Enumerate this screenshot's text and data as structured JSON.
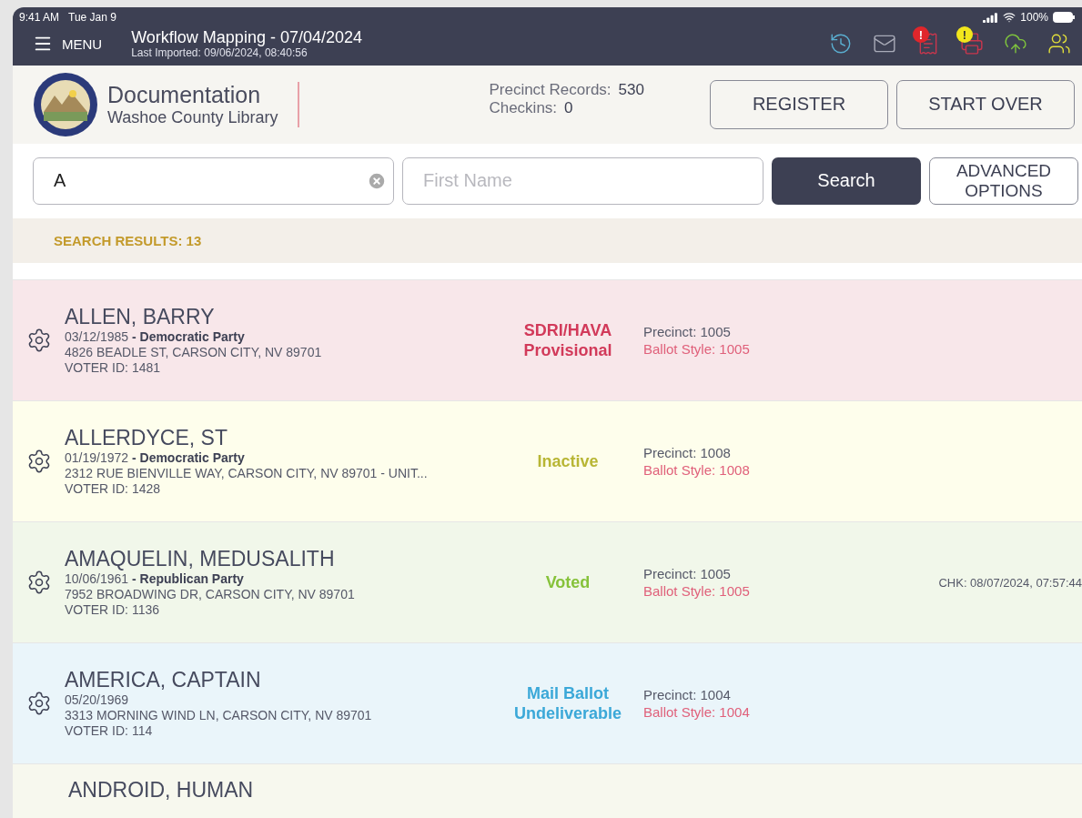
{
  "status_bar": {
    "time": "9:41 AM",
    "date": "Tue Jan 9",
    "battery": "100%"
  },
  "title_bar": {
    "menu": "MENU",
    "title": "Workflow Mapping - 07/04/2024",
    "subtitle": "Last Imported: 09/06/2024, 08:40:56",
    "tools": [
      {
        "kind": "history"
      },
      {
        "kind": "mail"
      },
      {
        "kind": "ballot",
        "badge": "!",
        "color": "#e0262b"
      },
      {
        "kind": "printer",
        "badge": "!",
        "color": "#f2e61c"
      },
      {
        "kind": "upload"
      },
      {
        "kind": "users"
      }
    ]
  },
  "header": {
    "title": "Documentation",
    "subtitle": "Washoe County Library",
    "stats": [
      {
        "label": "Precinct Records:",
        "value": "530"
      },
      {
        "label": "Checkins:",
        "value": "0"
      }
    ],
    "buttons": [
      "REGISTER",
      "START OVER"
    ]
  },
  "search": {
    "last_name": {
      "value": "A"
    },
    "first_name": {
      "placeholder": "First Name"
    },
    "search_button": "Search",
    "advanced_button": "ADVANCED OPTIONS"
  },
  "results": {
    "label": "SEARCH RESULTS: 13"
  },
  "rows": [
    {
      "kind": "provisional",
      "name": "ALLEN, BARRY",
      "details": "03/12/1985 **- Democratic Party**",
      "address": "4826 BEADLE ST, CARSON CITY, NV 89701",
      "voter_id": "VOTER ID: 1481",
      "status": "SDRI/HAVA Provisional",
      "precinct": "Precinct: 1005",
      "ballot_style": "Ballot Style: 1005",
      "checkin": null
    },
    {
      "kind": "inactive",
      "name": "ALLERDYCE, ST",
      "details": "01/19/1972 **- Democratic Party**",
      "address": "2312 RUE BIENVILLE WAY, CARSON CITY, NV 89701 - UNIT...",
      "voter_id": "VOTER ID: 1428",
      "status": "Inactive",
      "precinct": "Precinct: 1008",
      "ballot_style": "Ballot Style: 1008",
      "checkin": null
    },
    {
      "kind": "voted",
      "name": "AMAQUELIN, MEDUSALITH",
      "details": "10/06/1961 **- Republican Party**",
      "address": "7952 BROADWING DR, CARSON CITY, NV 89701",
      "voter_id": "VOTER ID: 1136",
      "status": "Voted",
      "precinct": "Precinct: 1005",
      "ballot_style": "Ballot Style: 1005",
      "checkin": "CHK: 08/07/2024, 07:57:44"
    },
    {
      "kind": "mail",
      "name": "AMERICA, CAPTAIN",
      "details": "05/20/1969",
      "address": "3313 MORNING WIND LN, CARSON CITY, NV 89701",
      "voter_id": "VOTER ID: 114",
      "status": "Mail Ballot Undeliverable",
      "precinct": "Precinct: 1004",
      "ballot_style": "Ballot Style: 1004",
      "checkin": null
    },
    {
      "kind": "partial",
      "name": "ANDROID, HUMAN"
    }
  ]
}
